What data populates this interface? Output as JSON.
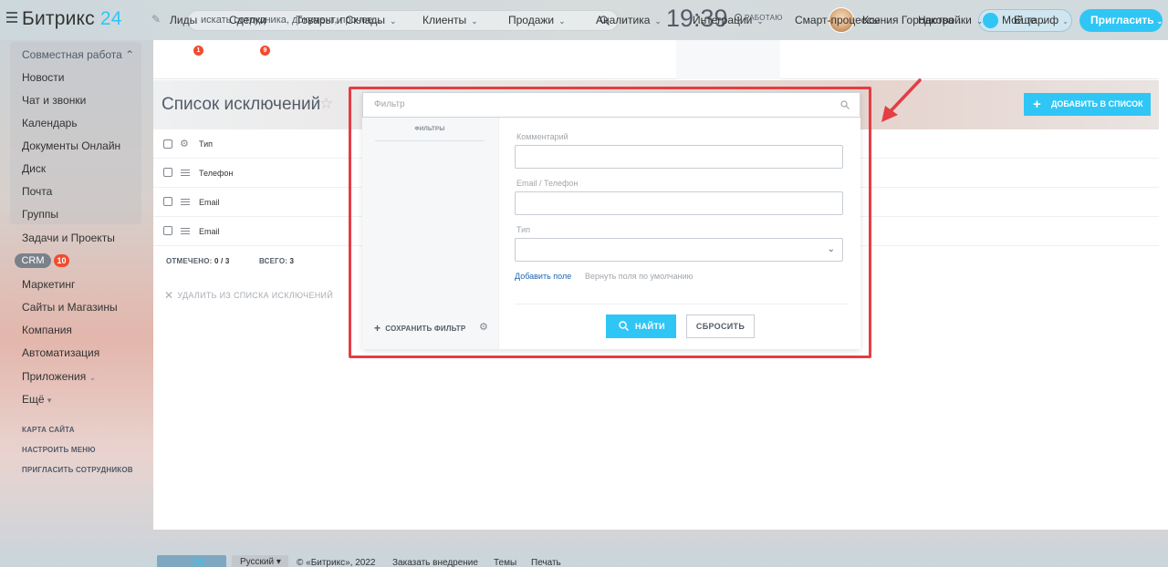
{
  "header": {
    "logo_text": "Битрикс",
    "logo_num": "24",
    "search_placeholder": "искать сотрудника, документ, прочее...",
    "clock": "19:39",
    "work_status": "РАБОТАЮ",
    "user_name": "Ксения Городкова",
    "tariff_label": "Мой тариф",
    "invite_label": "Пригласить"
  },
  "sidebar": {
    "group_title": "Совместная работа",
    "items": [
      "Новости",
      "Чат и звонки",
      "Календарь",
      "Документы Онлайн",
      "Диск",
      "Почта",
      "Группы",
      "Задачи и Проекты"
    ],
    "crm_label": "CRM",
    "crm_count": "10",
    "items_after": [
      "Маркетинг",
      "Сайты и Магазины",
      "Компания",
      "Автоматизация",
      "Приложения",
      "Ещё"
    ],
    "links": [
      "КАРТА САЙТА",
      "НАСТРОИТЬ МЕНЮ",
      "ПРИГЛАСИТЬ СОТРУДНИКОВ"
    ]
  },
  "tabs": [
    {
      "label": "Лиды",
      "badge": "1"
    },
    {
      "label": "Сделки",
      "badge": "9"
    },
    {
      "label": "Товары и Склады"
    },
    {
      "label": "Клиенты"
    },
    {
      "label": "Продажи"
    },
    {
      "label": "Аналитика"
    },
    {
      "label": "Интеграции"
    },
    {
      "label": "Смарт-процессы"
    },
    {
      "label": "Настройки"
    },
    {
      "label": "Еще"
    }
  ],
  "page": {
    "title": "Список исключений",
    "add_button": "ДОБАВИТЬ В СПИСОК"
  },
  "grid": {
    "header": "Тип",
    "rows": [
      "Телефон",
      "Email",
      "Email"
    ],
    "selected_label": "ОТМЕЧЕНО:",
    "selected_value": "0 / 3",
    "total_label": "ВСЕГО:",
    "total_value": "3",
    "delete_action": "УДАЛИТЬ ИЗ СПИСКА ИСКЛЮЧЕНИЙ"
  },
  "filter": {
    "placeholder": "Фильтр",
    "filters_head": "ФИЛЬТРЫ",
    "save_filter": "СОХРАНИТЬ ФИЛЬТР",
    "fields": [
      "Комментарий",
      "Email / Телефон",
      "Тип"
    ],
    "add_field": "Добавить поле",
    "restore_fields": "Вернуть поля по умолчанию",
    "find_button": "НАЙТИ",
    "reset_button": "СБРОСИТЬ"
  },
  "footer": {
    "logo": "24",
    "language": "Русский",
    "copyright": "© «Битрикс», 2022",
    "order": "Заказать внедрение",
    "themes": "Темы",
    "print": "Печать"
  },
  "colors": {
    "accent": "#2fc6f6",
    "badge": "#f04c2f",
    "highlight_frame": "#e33e45",
    "link": "#2067b0"
  }
}
